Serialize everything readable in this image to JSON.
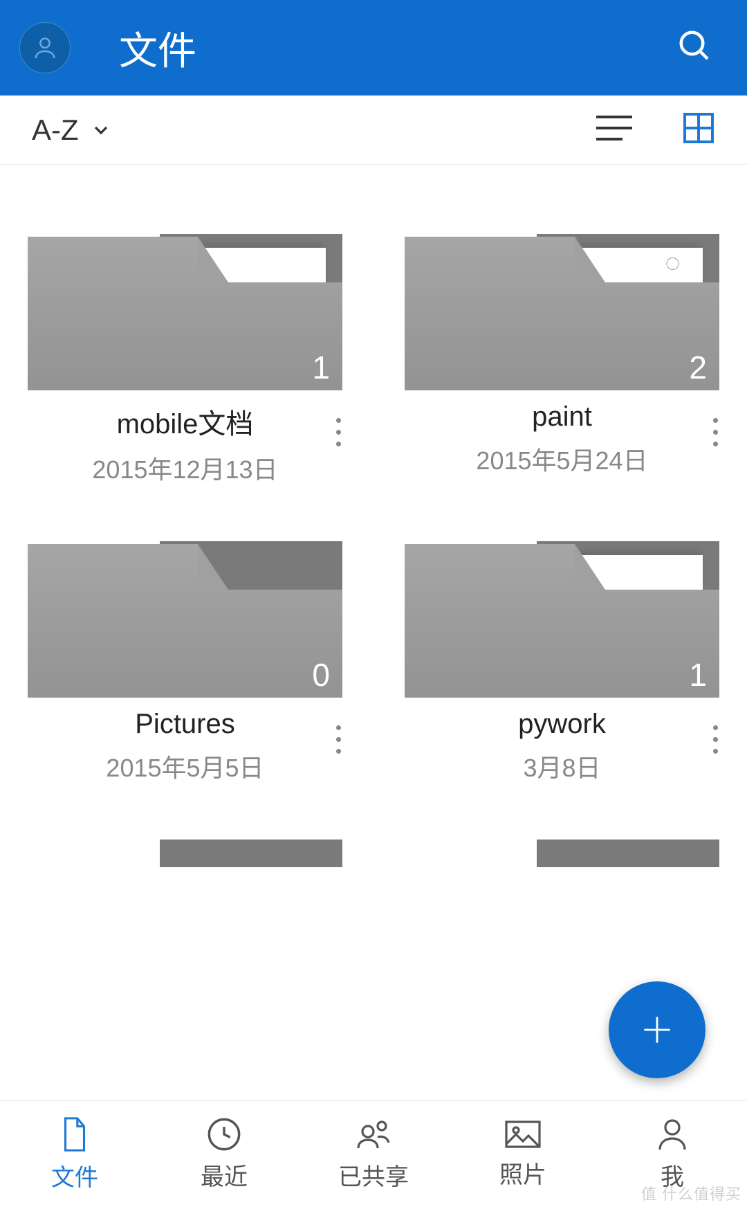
{
  "header": {
    "title": "文件"
  },
  "sortbar": {
    "sort_label": "A-Z"
  },
  "folders": [
    {
      "name": "mobile文档",
      "date": "2015年12月13日",
      "count": "1",
      "sketch": false
    },
    {
      "name": "paint",
      "date": "2015年5月24日",
      "count": "2",
      "sketch": true
    },
    {
      "name": "Pictures",
      "date": "2015年5月5日",
      "count": "0",
      "sketch": false
    },
    {
      "name": "pywork",
      "date": "3月8日",
      "count": "1",
      "sketch": false
    }
  ],
  "nav": {
    "files": "文件",
    "recent": "最近",
    "shared": "已共享",
    "photos": "照片",
    "me": "我"
  },
  "watermark": "值  什么值得买"
}
